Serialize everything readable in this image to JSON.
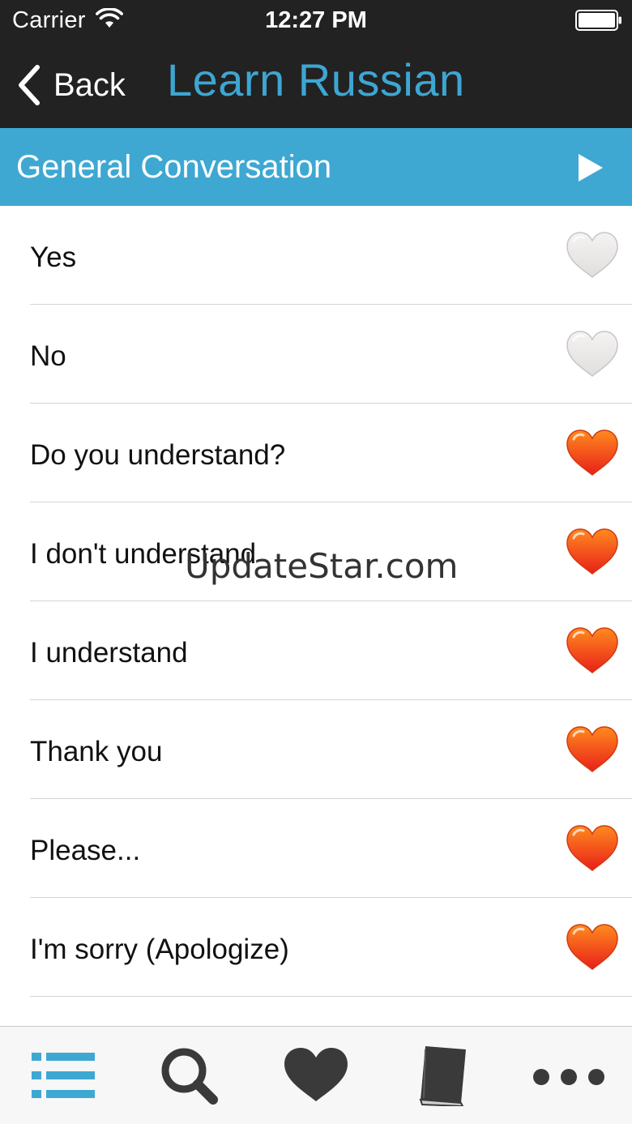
{
  "status_bar": {
    "carrier": "Carrier",
    "time": "12:27 PM",
    "wifi_icon": "wifi-icon",
    "battery_icon": "battery-icon"
  },
  "nav": {
    "back_label": "Back",
    "back_icon": "chevron-left-icon",
    "title": "Learn Russian"
  },
  "section": {
    "title": "General Conversation",
    "icon": "play-icon"
  },
  "list": {
    "items": [
      {
        "label": "Yes",
        "favorited": false
      },
      {
        "label": "No",
        "favorited": false
      },
      {
        "label": "Do you understand?",
        "favorited": true
      },
      {
        "label": "I don't understand",
        "favorited": true
      },
      {
        "label": "I understand",
        "favorited": true
      },
      {
        "label": "Thank you",
        "favorited": true
      },
      {
        "label": "Please...",
        "favorited": true
      },
      {
        "label": "I'm sorry (Apologize)",
        "favorited": true
      }
    ]
  },
  "watermark": "UpdateStar.com",
  "tab_bar": {
    "tabs": [
      {
        "icon": "list-icon",
        "active": true
      },
      {
        "icon": "search-icon",
        "active": false
      },
      {
        "icon": "heart-icon",
        "active": false
      },
      {
        "icon": "book-icon",
        "active": false
      },
      {
        "icon": "more-icon",
        "active": false
      }
    ]
  },
  "colors": {
    "bar_background": "#222222",
    "accent_blue": "#3ea8d2",
    "title_blue": "#3da6d2",
    "heart_favorite_top": "#ff8a1e",
    "heart_favorite_bottom": "#e8201a",
    "heart_empty": "#e2dede",
    "tab_icon": "#3a3a3a",
    "tab_icon_active": "#3ea8d2"
  }
}
